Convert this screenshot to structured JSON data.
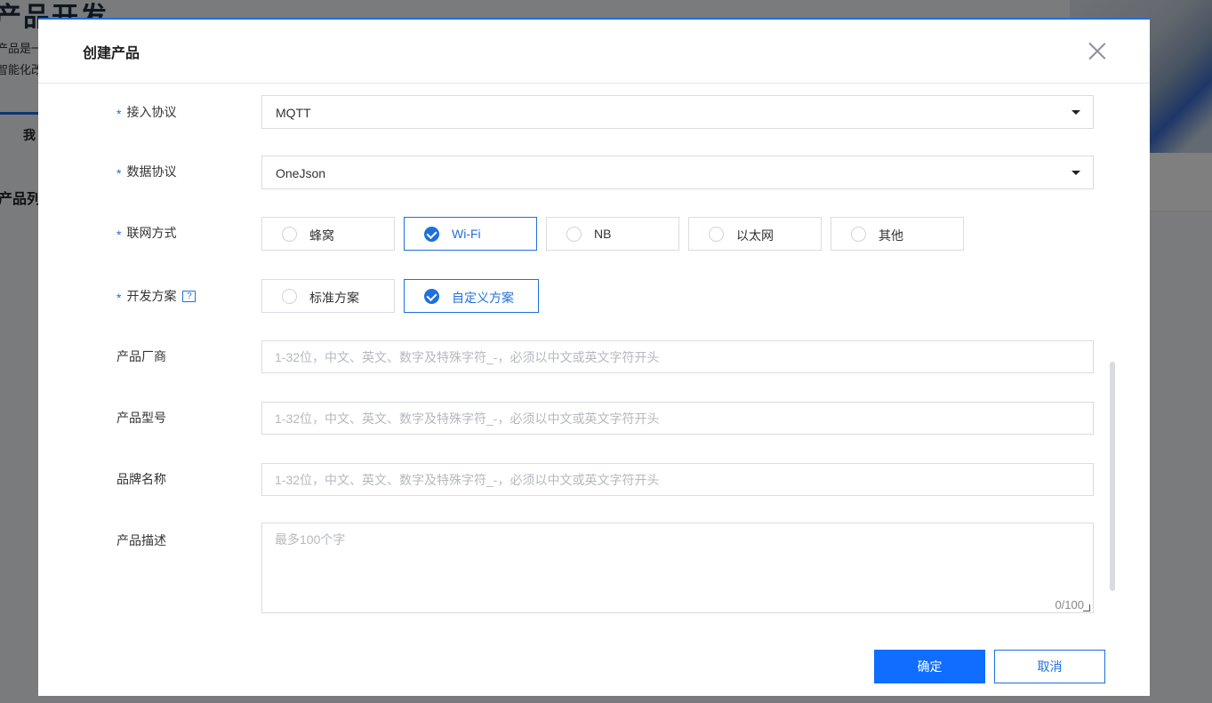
{
  "background": {
    "title": "产品开发",
    "desc_line1": "产品是一",
    "desc_line2": "智能化改",
    "tab": "我",
    "list_title": "产品列"
  },
  "modal": {
    "title": "创建产品",
    "fields": {
      "access_protocol": {
        "label": "接入协议",
        "value": "MQTT"
      },
      "data_protocol": {
        "label": "数据协议",
        "value": "OneJson"
      },
      "network": {
        "label": "联网方式",
        "options": [
          "蜂窝",
          "Wi-Fi",
          "NB",
          "以太网",
          "其他"
        ],
        "selected": "Wi-Fi"
      },
      "dev_plan": {
        "label": "开发方案",
        "help": "?",
        "options": [
          "标准方案",
          "自定义方案"
        ],
        "selected": "自定义方案"
      },
      "vendor": {
        "label": "产品厂商",
        "placeholder": "1-32位，中文、英文、数字及特殊字符_-，必须以中文或英文字符开头"
      },
      "model": {
        "label": "产品型号",
        "placeholder": "1-32位，中文、英文、数字及特殊字符_-，必须以中文或英文字符开头"
      },
      "brand": {
        "label": "品牌名称",
        "placeholder": "1-32位，中文、英文、数字及特殊字符_-，必须以中文或英文字符开头"
      },
      "description": {
        "label": "产品描述",
        "placeholder": "最多100个字",
        "counter": "0/100"
      }
    },
    "required_mark": "*",
    "confirm_label": "确定",
    "cancel_label": "取消"
  },
  "colors": {
    "accent": "#1f6fde",
    "primary_button": "#0f6dff"
  },
  "icons": [
    "close-icon",
    "help-icon",
    "caret-down-icon",
    "check-icon"
  ]
}
